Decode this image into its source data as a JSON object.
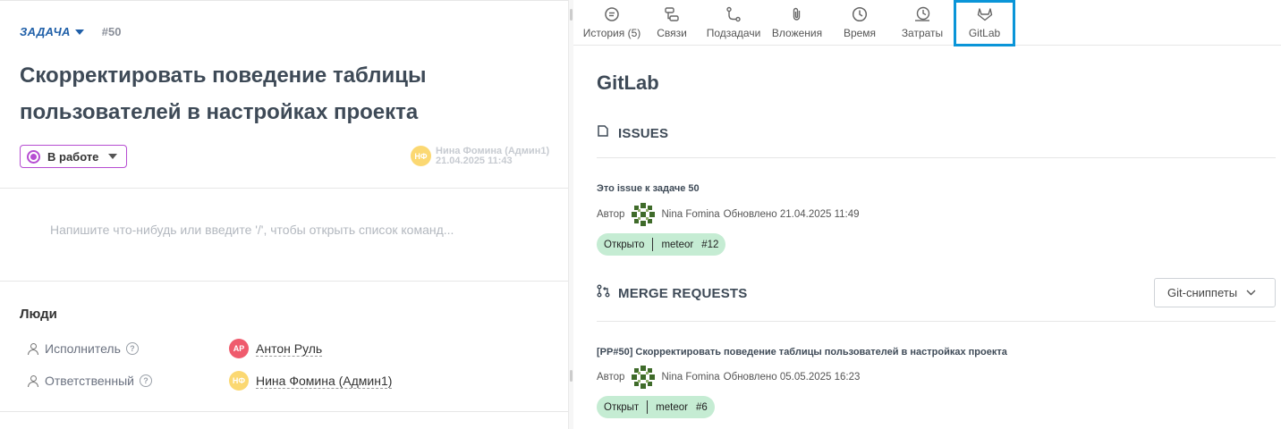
{
  "task": {
    "type_label": "ЗАДАЧА",
    "number": "#50",
    "title": "Скорректировать поведение таблицы пользователей в настройках проекта",
    "status": "В работе",
    "status_color": "#b64dd2",
    "author": {
      "initials": "НФ",
      "name": "Нина Фомина (Админ1)",
      "date": "21.04.2025 11:43"
    },
    "comment_placeholder": "Напишите что-нибудь или введите '/', чтобы открыть список команд..."
  },
  "people": {
    "title": "Люди",
    "rows": [
      {
        "role": "Исполнитель",
        "initials": "АР",
        "name": "Антон Руль",
        "avatar_color": "#ef5b6d"
      },
      {
        "role": "Ответственный",
        "initials": "НФ",
        "name": "Нина Фомина (Админ1)",
        "avatar_color": "#fbd872"
      }
    ]
  },
  "tabs": [
    {
      "label": "История (5)",
      "icon": "history-icon"
    },
    {
      "label": "Связи",
      "icon": "links-icon"
    },
    {
      "label": "Подзадачи",
      "icon": "subtasks-icon"
    },
    {
      "label": "Вложения",
      "icon": "paperclip-icon"
    },
    {
      "label": "Время",
      "icon": "clock-icon"
    },
    {
      "label": "Затраты",
      "icon": "costs-icon"
    },
    {
      "label": "GitLab",
      "icon": "gitlab-icon",
      "active": true
    }
  ],
  "gitlab": {
    "title": "GitLab",
    "issues_heading": "ISSUES",
    "issue": {
      "title": "Это issue к задаче 50",
      "author_label": "Автор",
      "author_name": "Nina Fomina",
      "updated": "Обновлено 21.04.2025 11:49",
      "state": "Открыто",
      "project": "meteor",
      "iid": "#12"
    },
    "mr_heading": "MERGE REQUESTS",
    "snippets_button": "Git-сниппеты",
    "mr": {
      "title": "[PP#50] Скорректировать поведение таблицы пользователей в настройках проекта",
      "author_label": "Автор",
      "author_name": "Nina Fomina",
      "updated": "Обновлено 05.05.2025 16:23",
      "state": "Открыт",
      "project": "meteor",
      "iid": "#6"
    },
    "accent_color": "#0a95d8",
    "pill_color": "#c5ecd3"
  }
}
